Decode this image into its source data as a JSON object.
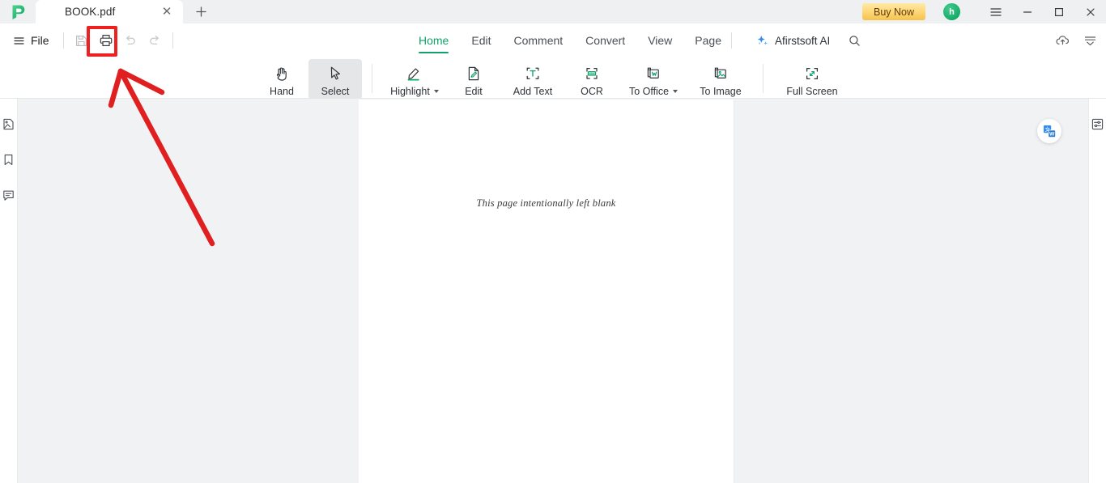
{
  "app": {
    "logo_icon": "afirstsoft-p-logo",
    "window_controls": [
      {
        "name": "hamburger-menu",
        "icon": "hamburger-icon"
      },
      {
        "name": "minimize",
        "icon": "minimize-icon"
      },
      {
        "name": "maximize",
        "icon": "maximize-icon"
      },
      {
        "name": "close",
        "icon": "close-icon"
      }
    ]
  },
  "titlebar": {
    "tab": {
      "title": "BOOK.pdf",
      "close_icon": "close-icon"
    },
    "new_tab_icon": "plus-icon",
    "buy_now_label": "Buy Now",
    "buy_now_color": "#ffd878",
    "avatar_initial": "h",
    "avatar_color": "#14a966"
  },
  "quickbar": {
    "file_label": "File",
    "file_menu_icon": "hamburger-icon",
    "buttons": [
      {
        "name": "save-button",
        "icon": "save-icon",
        "enabled": true
      },
      {
        "name": "print-button",
        "icon": "printer-icon",
        "enabled": true,
        "highlighted": true
      },
      {
        "name": "undo-button",
        "icon": "undo-icon",
        "enabled": false
      },
      {
        "name": "redo-button",
        "icon": "redo-icon",
        "enabled": false
      }
    ]
  },
  "menu_tabs": [
    {
      "label": "Home",
      "active": true
    },
    {
      "label": "Edit",
      "active": false
    },
    {
      "label": "Comment",
      "active": false
    },
    {
      "label": "Convert",
      "active": false
    },
    {
      "label": "View",
      "active": false
    },
    {
      "label": "Page",
      "active": false
    }
  ],
  "menu_active_color": "#12a16a",
  "ai": {
    "label": "Afirstsoft AI",
    "sparkle_icon": "sparkle-icon",
    "sparkle_color": "#2f8cf5",
    "search_icon": "search-icon"
  },
  "header_right_icons": [
    {
      "name": "cloud-upload-icon",
      "label": "cloud-upload"
    },
    {
      "name": "collapse-ribbon-icon",
      "label": "collapse-ribbon"
    }
  ],
  "tools": [
    {
      "label": "Hand",
      "icon": "hand-icon",
      "active": false,
      "dropdown": false
    },
    {
      "label": "Select",
      "icon": "cursor-arrow-icon",
      "active": true,
      "dropdown": false
    },
    {
      "label": "Highlight",
      "icon": "highlighter-icon",
      "active": false,
      "dropdown": true
    },
    {
      "label": "Edit",
      "icon": "edit-pencil-page-icon",
      "active": false,
      "dropdown": false
    },
    {
      "label": "Add Text",
      "icon": "add-text-icon",
      "active": false,
      "dropdown": false
    },
    {
      "label": "OCR",
      "icon": "ocr-icon",
      "active": false,
      "dropdown": false
    },
    {
      "label": "To Office",
      "icon": "to-office-icon",
      "active": false,
      "dropdown": true
    },
    {
      "label": "To Image",
      "icon": "to-image-icon",
      "active": false,
      "dropdown": false
    },
    {
      "label": "Full Screen",
      "icon": "full-screen-icon",
      "active": false,
      "dropdown": false
    }
  ],
  "sidebar_left": [
    {
      "name": "thumbnails-icon",
      "label": "Thumbnails"
    },
    {
      "name": "bookmark-icon",
      "label": "Bookmarks"
    },
    {
      "name": "comment-icon",
      "label": "Comments"
    }
  ],
  "sidebar_right": [
    {
      "name": "properties-sliders-icon",
      "label": "Properties"
    }
  ],
  "document": {
    "page_text": "This page intentionally left blank",
    "translate_badge_icon": "translate-to-word-icon"
  },
  "annotation": {
    "highlight_color": "#ef2020",
    "highlight_target": "print-button",
    "arrow_color": "#e02020"
  }
}
